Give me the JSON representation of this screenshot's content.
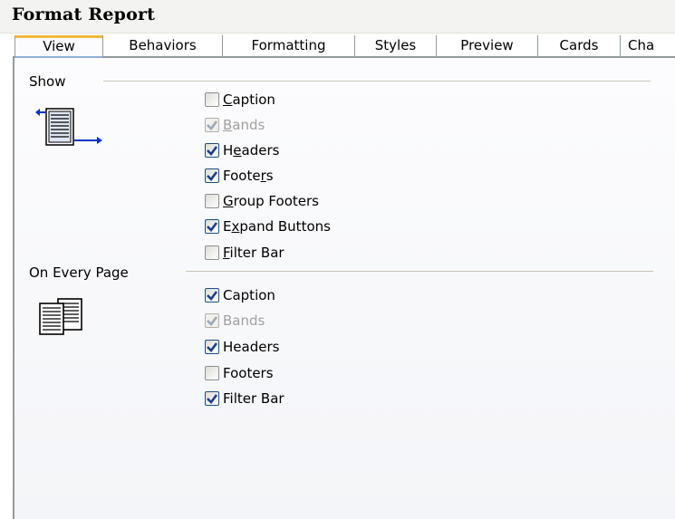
{
  "window": {
    "title": "Format Report"
  },
  "tabs": [
    {
      "label": "View",
      "active": true
    },
    {
      "label": "Behaviors",
      "active": false
    },
    {
      "label": "Formatting",
      "active": false
    },
    {
      "label": "Styles",
      "active": false
    },
    {
      "label": "Preview",
      "active": false
    },
    {
      "label": "Cards",
      "active": false
    },
    {
      "label": "Cha",
      "active": false
    }
  ],
  "show": {
    "label": "Show",
    "icon": "report-layout-icon",
    "items": [
      {
        "pre": "",
        "mnemonic": "C",
        "post": "aption",
        "checked": false,
        "enabled": true
      },
      {
        "pre": "",
        "mnemonic": "B",
        "post": "ands",
        "checked": true,
        "enabled": false
      },
      {
        "pre": "H",
        "mnemonic": "e",
        "post": "aders",
        "checked": true,
        "enabled": true
      },
      {
        "pre": "Foote",
        "mnemonic": "r",
        "post": "s",
        "checked": true,
        "enabled": true
      },
      {
        "pre": "",
        "mnemonic": "G",
        "post": "roup Footers",
        "checked": false,
        "enabled": true
      },
      {
        "pre": "E",
        "mnemonic": "x",
        "post": "pand Buttons",
        "checked": true,
        "enabled": true
      },
      {
        "pre": "",
        "mnemonic": "F",
        "post": "ilter Bar",
        "checked": false,
        "enabled": true
      }
    ]
  },
  "every_page": {
    "label": "On Every Page",
    "icon": "pages-icon",
    "items": [
      {
        "pre": "Caption",
        "mnemonic": "",
        "post": "",
        "checked": true,
        "enabled": true
      },
      {
        "pre": "Bands",
        "mnemonic": "",
        "post": "",
        "checked": true,
        "enabled": false
      },
      {
        "pre": "Headers",
        "mnemonic": "",
        "post": "",
        "checked": true,
        "enabled": true
      },
      {
        "pre": "Footers",
        "mnemonic": "",
        "post": "",
        "checked": false,
        "enabled": true
      },
      {
        "pre": "Filter Bar",
        "mnemonic": "",
        "post": "",
        "checked": true,
        "enabled": true
      }
    ]
  }
}
